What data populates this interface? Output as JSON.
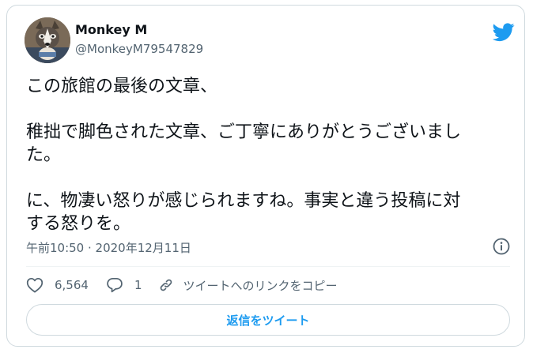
{
  "author": {
    "display_name": "Monkey M",
    "handle": "@MonkeyM79547829",
    "avatar_icon": "husky-dog-avatar"
  },
  "tweet": {
    "text": "この旅館の最後の文章、\n\n稚拙で脚色された文章、ご丁寧にありがとうございまし\nた。\n\nに、物凄い怒りが感じられますね。事実と違う投稿に対\nする怒りを。",
    "timestamp": "午前10:50 · 2020年12月11日"
  },
  "actions": {
    "like_count": "6,564",
    "reply_count": "1",
    "copy_link_label": "ツイートへのリンクをコピー"
  },
  "reply_button": {
    "label": "返信をツイート"
  },
  "icons": {
    "brand": "twitter-bird-icon",
    "info": "info-icon",
    "like": "heart-icon",
    "reply": "speech-bubble-icon",
    "link": "link-icon"
  },
  "colors": {
    "brand_blue": "#1d9bf0",
    "text_primary": "#0f1419",
    "text_secondary": "#536471",
    "border": "#cfd9de"
  }
}
